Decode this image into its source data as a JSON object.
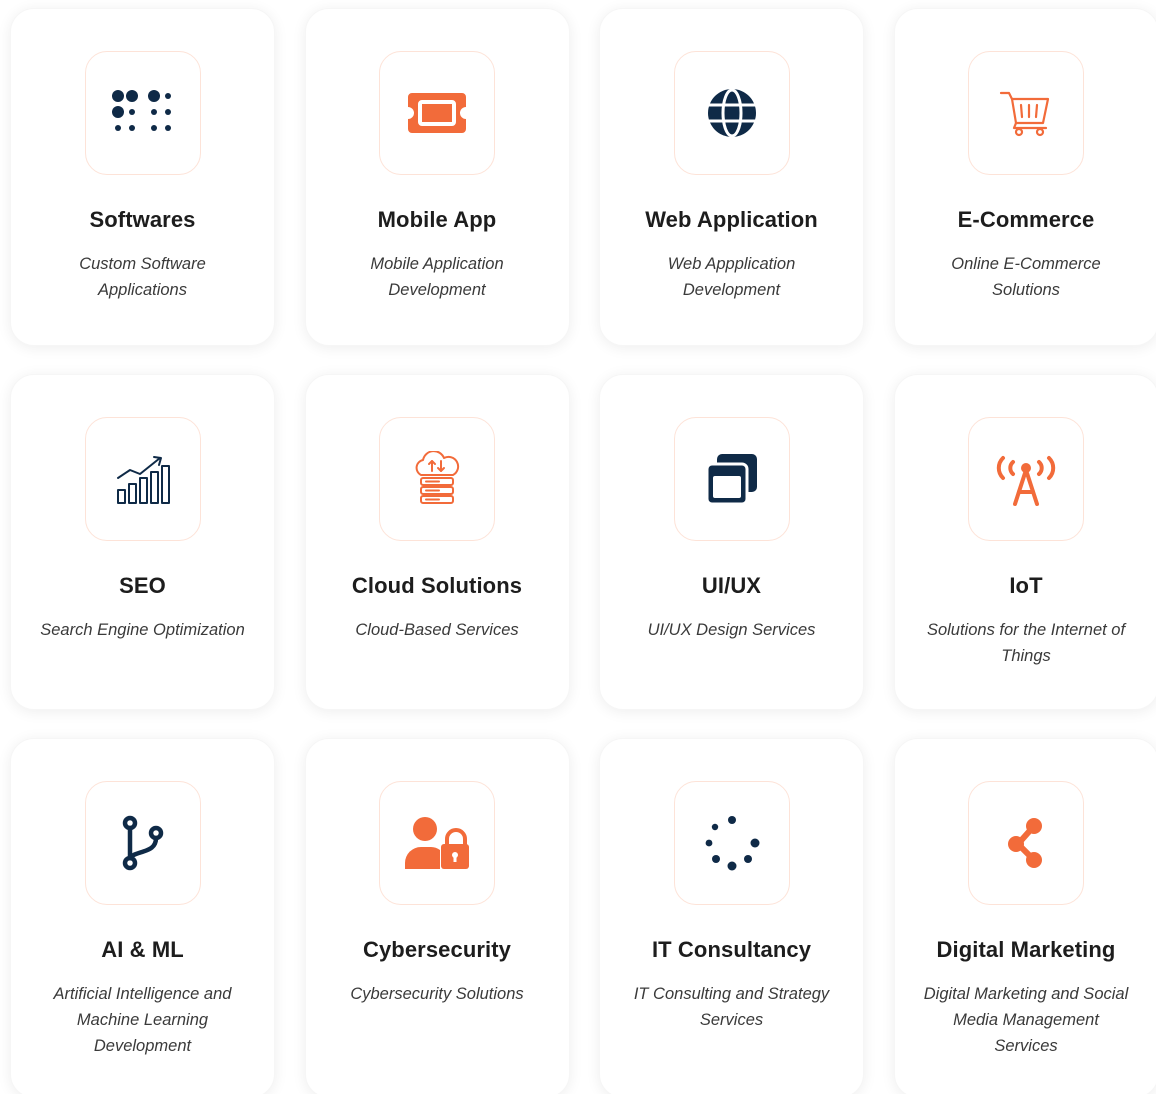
{
  "colors": {
    "navy": "#0f2a47",
    "orange": "#f26b3a"
  },
  "cards": [
    {
      "icon": "braille-icon",
      "title": "Softwares",
      "line1": "Custom Software",
      "line2": "Applications",
      "line3": ""
    },
    {
      "icon": "ticket-icon",
      "title": "Mobile App",
      "line1": "Mobile Application",
      "line2": "Development",
      "line3": ""
    },
    {
      "icon": "globe-icon",
      "title": "Web Application",
      "line1": "Web Appplication",
      "line2": "Development",
      "line3": ""
    },
    {
      "icon": "shopping-cart-icon",
      "title": "E-Commerce",
      "line1": "Online E-Commerce",
      "line2": "Solutions",
      "line3": ""
    },
    {
      "icon": "growth-chart-icon",
      "title": "SEO",
      "line1": "Search Engine Optimization",
      "line2": "",
      "line3": ""
    },
    {
      "icon": "cloud-server-icon",
      "title": "Cloud Solutions",
      "line1": "Cloud-Based Services",
      "line2": "",
      "line3": ""
    },
    {
      "icon": "windows-icon",
      "title": "UI/UX",
      "line1": "UI/UX Design Services",
      "line2": "",
      "line3": ""
    },
    {
      "icon": "broadcast-tower-icon",
      "title": "IoT",
      "line1": "Solutions for the Internet of",
      "line2": "Things",
      "line3": ""
    },
    {
      "icon": "code-branch-icon",
      "title": "AI & ML",
      "line1": "Artificial Intelligence and",
      "line2": "Machine Learning",
      "line3": "Development"
    },
    {
      "icon": "user-lock-icon",
      "title": "Cybersecurity",
      "line1": "Cybersecurity Solutions",
      "line2": "",
      "line3": ""
    },
    {
      "icon": "spinner-icon",
      "title": "IT Consultancy",
      "line1": "IT Consulting and Strategy",
      "line2": "Services",
      "line3": ""
    },
    {
      "icon": "share-nodes-icon",
      "title": "Digital Marketing",
      "line1": "Digital Marketing and Social",
      "line2": "Media Management",
      "line3": "Services"
    }
  ]
}
